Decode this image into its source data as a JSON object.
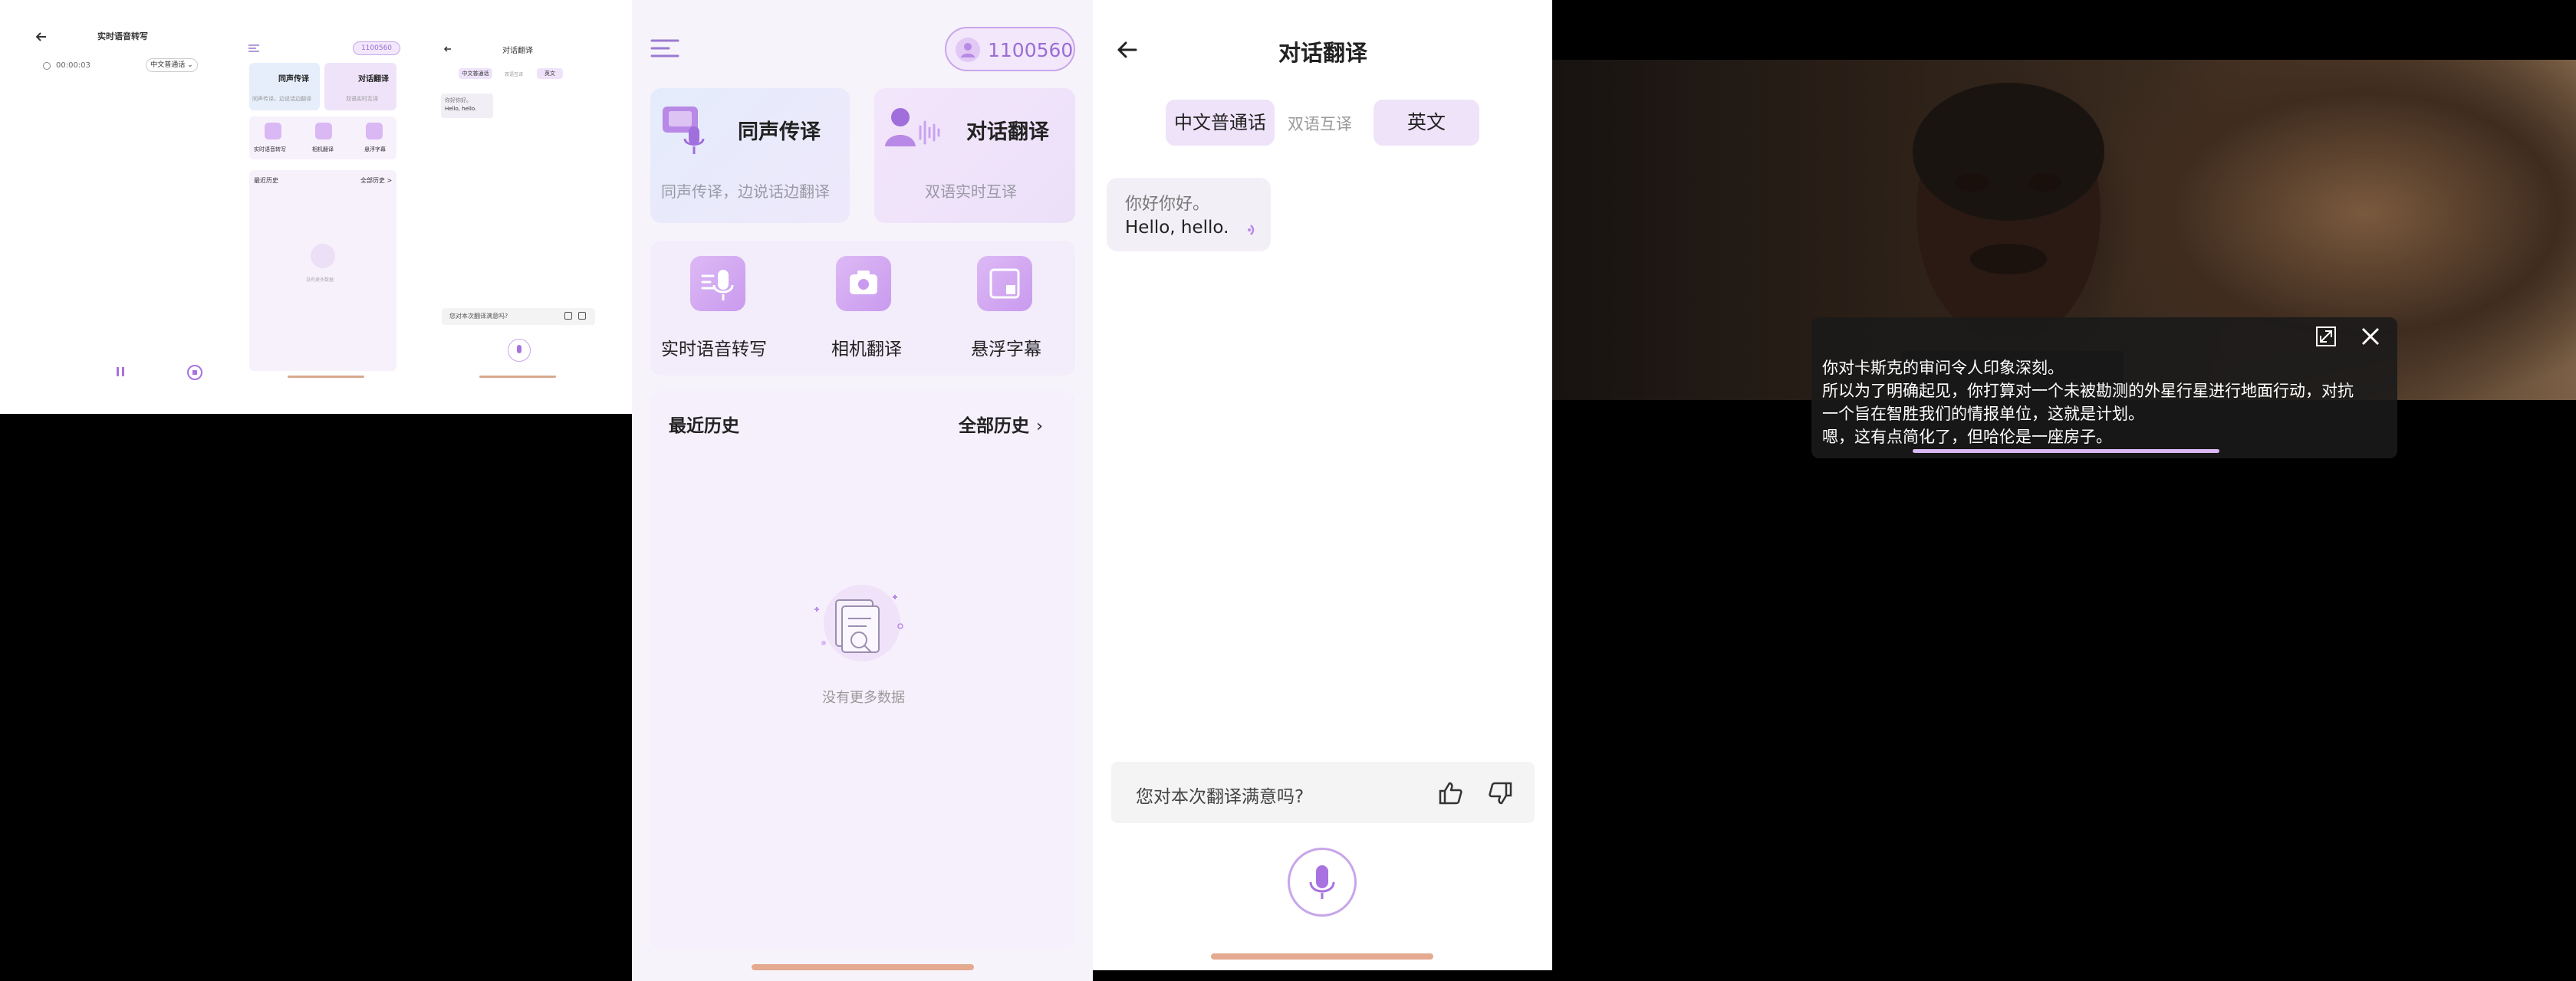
{
  "thumbs": {
    "transcribe": {
      "title": "实时语音转写",
      "timer": "00:00:03",
      "lang": "中文普通话"
    },
    "home": {
      "user_id": "1100560",
      "card1_title": "同声传译",
      "card1_sub": "同声传译，边说话边翻译",
      "card2_title": "对话翻译",
      "card2_sub": "双语实时互译",
      "tool1": "实时语音转写",
      "tool2": "相机翻译",
      "tool3": "悬浮字幕",
      "history_title": "最近历史",
      "history_all": "全部历史 >",
      "empty": "没有更多数据"
    },
    "dialog": {
      "title": "对话翻译",
      "lang_left": "中文普通话",
      "mode": "双语互译",
      "lang_right": "英文",
      "msg_zh": "你好你好。",
      "msg_en": "Hello, hello.",
      "feedback": "您对本次翻译满意吗?"
    }
  },
  "home": {
    "user_id": "1100560",
    "card1_title": "同声传译",
    "card1_sub": "同声传译，边说话边翻译",
    "card2_title": "对话翻译",
    "card2_sub": "双语实时互译",
    "tools": [
      "实时语音转写",
      "相机翻译",
      "悬浮字幕"
    ],
    "history_title": "最近历史",
    "history_all": "全部历史",
    "empty": "没有更多数据"
  },
  "dialog": {
    "title": "对话翻译",
    "lang_left": "中文普通话",
    "mode": "双语互译",
    "lang_right": "英文",
    "msg_zh": "你好你好。",
    "msg_en": "Hello, hello.",
    "feedback": "您对本次翻译满意吗?"
  },
  "subtitle": {
    "lines": [
      "你对卡斯克的审问令人印象深刻。",
      "所以为了明确起见，你打算对一个未被勘测的外星行星进行地面行动，对抗",
      "一个旨在智胜我们的情报单位，这就是计划。",
      "嗯，这有点简化了，但哈伦是一座房子。"
    ]
  },
  "colors": {
    "accent": "#b889e6",
    "accent_light": "#ead9f7",
    "card_blue": "#e6eefb",
    "card_purple": "#efe3fa"
  }
}
